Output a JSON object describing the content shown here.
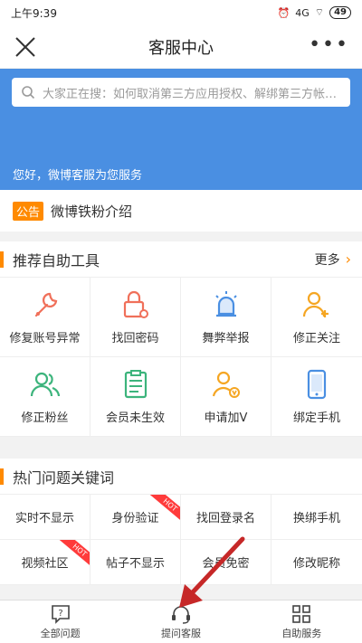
{
  "status_bar": {
    "time": "上午9:39",
    "network": "4G",
    "battery": "49"
  },
  "nav": {
    "title": "客服中心",
    "more": "•••"
  },
  "search": {
    "placeholder": "大家正在搜：如何取消第三方应用授权、解绑第三方帐…"
  },
  "hero": {
    "greeting": "您好，微博客服为您服务"
  },
  "notice": {
    "tag": "公告",
    "text": "微博铁粉介绍"
  },
  "tools": {
    "title": "推荐自助工具",
    "more_label": "更多",
    "items": [
      {
        "label": "修复账号异常",
        "icon": "wrench-icon",
        "color": "#f0705a"
      },
      {
        "label": "找回密码",
        "icon": "lock-icon",
        "color": "#f0705a"
      },
      {
        "label": "舞弊举报",
        "icon": "siren-icon",
        "color": "#4a8fe2"
      },
      {
        "label": "修正关注",
        "icon": "user-add-icon",
        "color": "#f5a623"
      },
      {
        "label": "修正粉丝",
        "icon": "users-icon",
        "color": "#3cb47c"
      },
      {
        "label": "会员未生效",
        "icon": "clipboard-icon",
        "color": "#3cb47c"
      },
      {
        "label": "申请加V",
        "icon": "user-v-icon",
        "color": "#f5a623"
      },
      {
        "label": "绑定手机",
        "icon": "phone-icon",
        "color": "#4a8fe2"
      }
    ]
  },
  "keywords": {
    "title": "热门问题关键词",
    "hot_label": "HOT",
    "items": [
      {
        "label": "实时不显示",
        "hot": false
      },
      {
        "label": "身份验证",
        "hot": true
      },
      {
        "label": "找回登录名",
        "hot": false
      },
      {
        "label": "换绑手机",
        "hot": false
      },
      {
        "label": "视频社区",
        "hot": true
      },
      {
        "label": "帖子不显示",
        "hot": false
      },
      {
        "label": "会员免密",
        "hot": false
      },
      {
        "label": "修改昵称",
        "hot": false
      }
    ]
  },
  "tabbar": {
    "items": [
      {
        "label": "全部问题",
        "icon": "question-icon"
      },
      {
        "label": "提问客服",
        "icon": "headset-icon"
      },
      {
        "label": "自助服务",
        "icon": "grid-icon"
      }
    ]
  },
  "colors": {
    "brand_blue": "#4a8fe2",
    "accent_orange": "#ff8a00",
    "hot_red": "#ff3b3b"
  }
}
